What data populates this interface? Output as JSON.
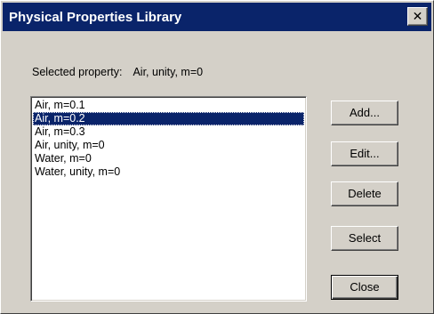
{
  "window": {
    "title": "Physical Properties Library",
    "close_glyph": "✕"
  },
  "selected_property": {
    "label": "Selected property:",
    "value": "Air, unity, m=0"
  },
  "list": {
    "items": [
      "Air, m=0.1",
      "Air, m=0.2",
      "Air, m=0.3",
      "Air, unity, m=0",
      "Water, m=0",
      "Water, unity, m=0"
    ],
    "highlighted_item": "Air, m=0.2"
  },
  "buttons": {
    "add": "Add...",
    "edit": "Edit...",
    "delete": "Delete",
    "select": "Select",
    "close": "Close"
  },
  "colors": {
    "titlebar": "#0a246a",
    "face": "#d4d0c8",
    "selection": "#0a246a"
  }
}
